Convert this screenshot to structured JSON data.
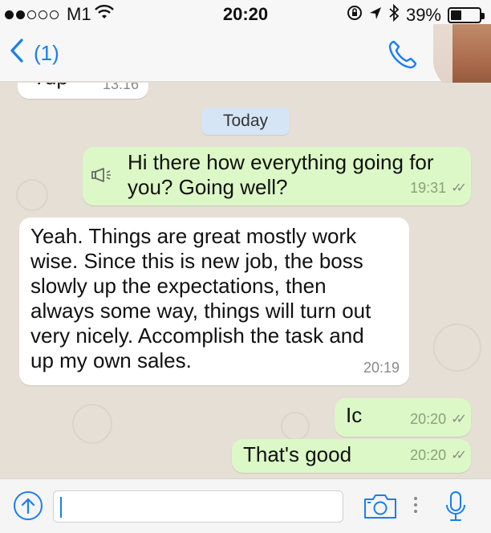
{
  "status_bar": {
    "carrier": "M1",
    "time": "20:20",
    "battery": "39%",
    "battery_level": 0.39
  },
  "nav": {
    "back_count": "(1)"
  },
  "chat": {
    "prev_message_fragment": "Yup",
    "prev_message_time": "13:16",
    "date_label": "Today",
    "messages": [
      {
        "direction": "out",
        "text_lines": [
          "Hi there how everything going for",
          "you? Going well?"
        ],
        "time": "19:31"
      },
      {
        "direction": "in",
        "text_lines": [
          "Yeah. Things are great mostly work",
          "wise. Since this is new job, the boss",
          "slowly up the expectations, then",
          "always some way, things will turn out",
          "very nicely. Accomplish the task and",
          "up my own sales."
        ],
        "time": "20:19"
      },
      {
        "direction": "out",
        "text": "Ic",
        "time": "20:20"
      },
      {
        "direction": "out",
        "text": "That's good",
        "time": "20:20"
      }
    ]
  },
  "input": {
    "value": "",
    "placeholder": ""
  },
  "colors": {
    "accent": "#1a7ef0",
    "outgoing_bubble": "#dcf8c6",
    "incoming_bubble": "#ffffff",
    "chat_background": "#e6dfd5",
    "date_pill": "#d5e5f5"
  },
  "icons": [
    "signal-dots-icon",
    "wifi-icon",
    "rotation-lock-icon",
    "location-icon",
    "bluetooth-icon",
    "battery-icon",
    "back-chevron-icon",
    "phone-icon",
    "megaphone-icon",
    "double-tick-icon",
    "upload-icon",
    "camera-icon",
    "microphone-icon"
  ]
}
